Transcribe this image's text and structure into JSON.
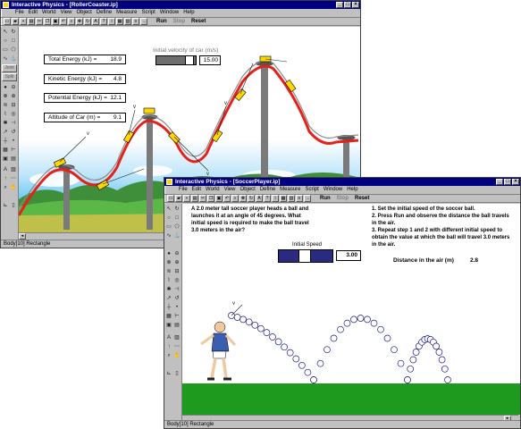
{
  "app_name": "Interactive Physics",
  "window1": {
    "title": "Interactive Physics - [RollerCoaster.ip]",
    "menus": [
      "File",
      "Edit",
      "World",
      "View",
      "Object",
      "Define",
      "Measure",
      "Script",
      "Window",
      "Help"
    ],
    "run_label": "Run",
    "stop_label": "Stop",
    "reset_label": "Reset",
    "palette_joints": [
      "Joint",
      "Split"
    ],
    "meters": [
      {
        "label": "Total Energy (kJ) =",
        "value": "18.9"
      },
      {
        "label": "Kinetic Energy  (kJ) =",
        "value": "4.8"
      },
      {
        "label": "Potential Energy (kJ) =",
        "value": "12.1"
      },
      {
        "label": "Altitude of Car (m) =",
        "value": "9.1"
      }
    ],
    "slider_label": "Initial velocity of car (m/s)",
    "slider_value": "15.00",
    "status": "Body[10] Rectangle",
    "colors": {
      "track": "#e8201a",
      "sky": "#00a6e8",
      "ground": "#4aa84a",
      "pillar": "#7a7a7a"
    }
  },
  "window2": {
    "title": "Interactive Physics - [SoccerPlayer.ip]",
    "menus": [
      "File",
      "Edit",
      "World",
      "View",
      "Object",
      "Define",
      "Measure",
      "Script",
      "Window",
      "Help"
    ],
    "run_label": "Run",
    "stop_label": "Stop",
    "reset_label": "Reset",
    "problem_text": "A 2.0 meter tall soccer player heads a ball and launches it at an angle of 45 degrees. What initial speed is required to make the ball travel 3.0 meters in the air?",
    "instructions": [
      "1. Set the initial speed of the soccer ball.",
      "2. Press Run and observe the distance the ball travels in the air.",
      "3. Repeat step 1 and 2 with different initial speed to obtain the value at which the ball will travel 3.0 meters in the air."
    ],
    "slider_label": "Initial Speed",
    "slider_value": "3.00",
    "distance_label": "Distance in the air (m)",
    "distance_value": "2.8",
    "status": "Body[10] Rectangle",
    "colors": {
      "field": "#1e9a1e",
      "slider": "#2a2a80"
    }
  }
}
